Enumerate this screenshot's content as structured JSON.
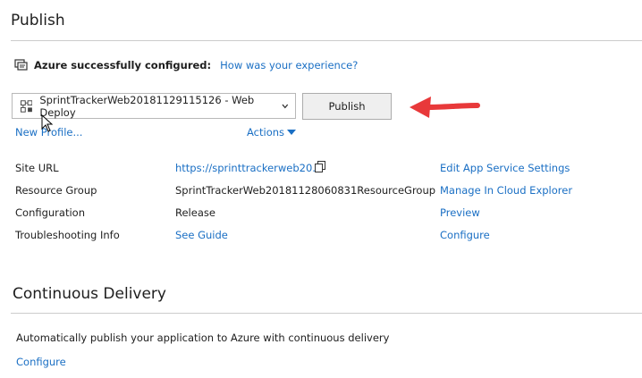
{
  "header": {
    "title": "Publish"
  },
  "status": {
    "message": "Azure successfully configured:",
    "feedback_link": "How was your experience?"
  },
  "profile": {
    "selected": "SprintTrackerWeb20181129115126 - Web Deploy",
    "publish_label": "Publish",
    "new_profile_label": "New Profile...",
    "actions_label": "Actions"
  },
  "details": {
    "site_url_label": "Site URL",
    "site_url_value": "https://sprinttrackerweb20...",
    "resource_group_label": "Resource Group",
    "resource_group_value": "SprintTrackerWeb20181128060831ResourceGroup",
    "configuration_label": "Configuration",
    "configuration_value": "Release",
    "troubleshooting_label": "Troubleshooting Info",
    "troubleshooting_value": "See Guide"
  },
  "actions": {
    "edit_settings": "Edit App Service Settings",
    "cloud_explorer": "Manage In Cloud Explorer",
    "preview": "Preview",
    "configure": "Configure"
  },
  "continuous_delivery": {
    "title": "Continuous Delivery",
    "description": "Automatically publish your application to Azure with continuous delivery",
    "configure": "Configure"
  },
  "colors": {
    "link": "#1a6fc4",
    "arrow": "#e8393a",
    "button_bg": "#efefef"
  }
}
